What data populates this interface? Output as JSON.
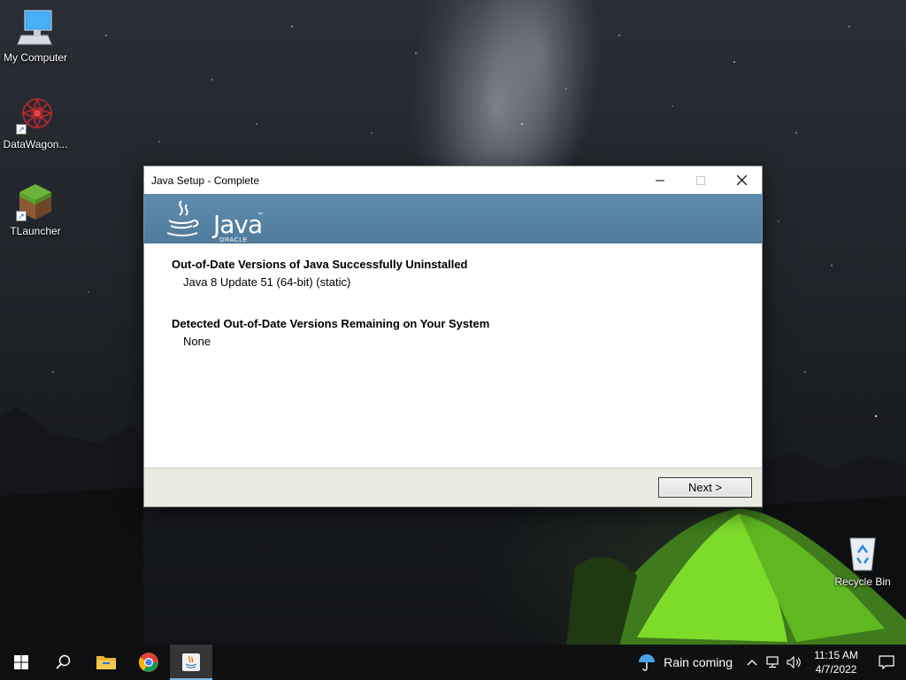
{
  "desktop": {
    "icons": [
      {
        "label": "My Computer",
        "icon": "computer-icon"
      },
      {
        "label": "DataWagon...",
        "icon": "datawagon-icon"
      },
      {
        "label": "TLauncher",
        "icon": "minecraft-grass-block-icon"
      },
      {
        "label": "Recycle Bin",
        "icon": "recycle-bin-icon"
      }
    ]
  },
  "window": {
    "title": "Java Setup - Complete",
    "logo": {
      "text": "Java",
      "subtext": "ORACLE",
      "tm": "™"
    },
    "sections": [
      {
        "heading": "Out-of-Date Versions of Java Successfully Uninstalled",
        "items": [
          "Java 8 Update 51 (64-bit) (static)"
        ]
      },
      {
        "heading": "Detected Out-of-Date Versions Remaining on Your System",
        "items": [
          "None"
        ]
      }
    ],
    "next_label": "Next >",
    "banner_color": "#5a87a8"
  },
  "taskbar": {
    "apps": [
      "start-icon",
      "search-icon",
      "file-explorer-icon",
      "chrome-icon",
      "java-setup-icon"
    ],
    "weather": {
      "text": "Rain coming",
      "icon": "umbrella-icon"
    },
    "clock": {
      "time": "11:15 AM",
      "date": "4/7/2022"
    },
    "accent_color": "#7ab3e6"
  }
}
